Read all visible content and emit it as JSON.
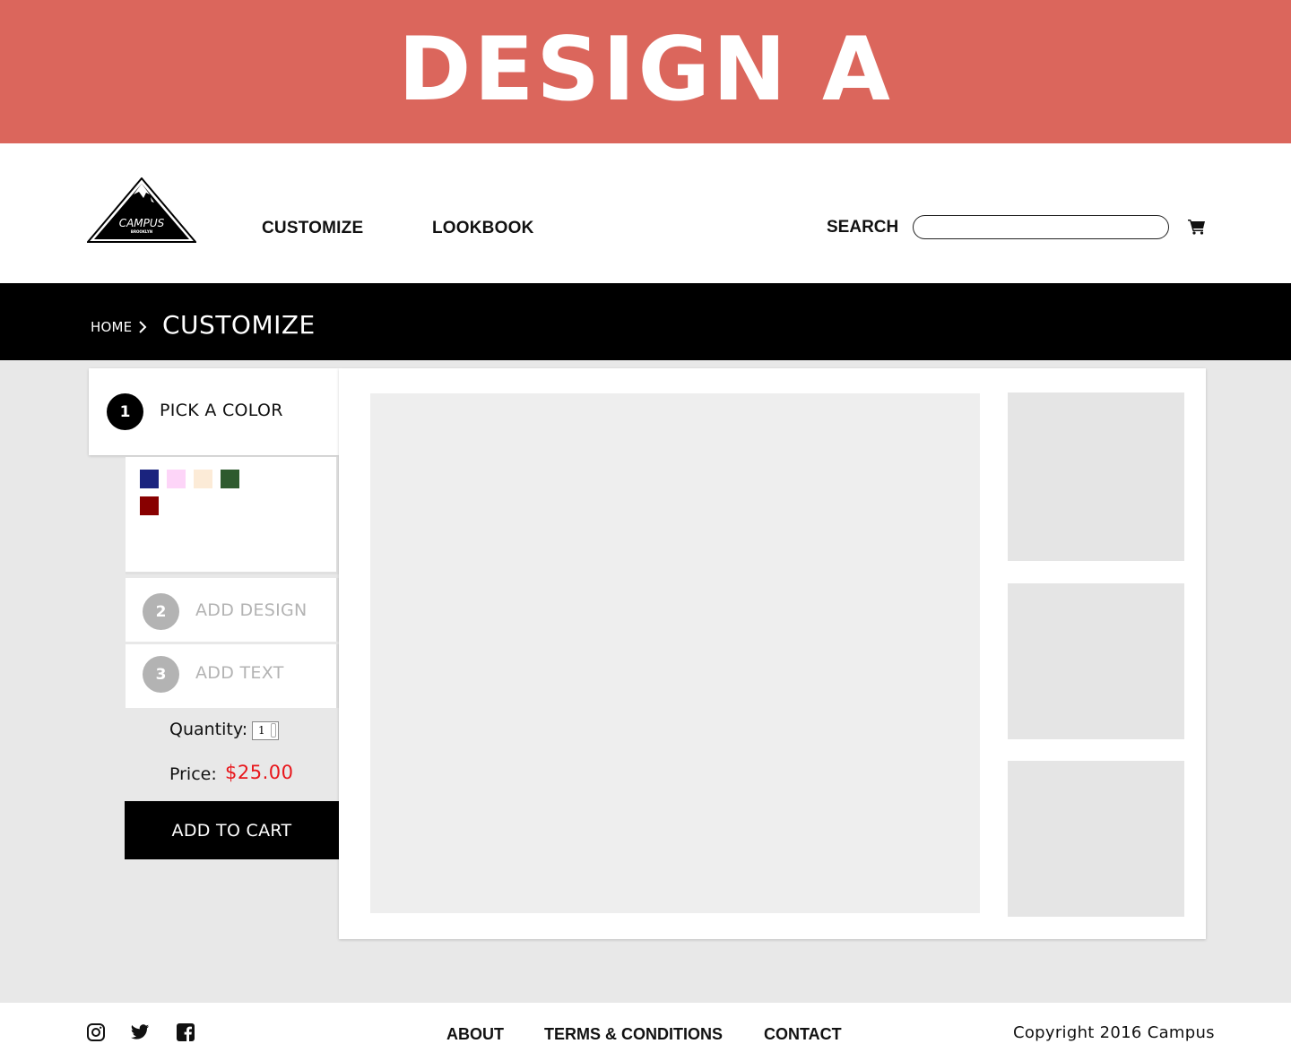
{
  "banner": {
    "title": "DESIGN A"
  },
  "header": {
    "logo": {
      "text": "CAMPUS",
      "subtext": "BROOKLYN"
    },
    "nav": [
      {
        "label": "CUSTOMIZE"
      },
      {
        "label": "LOOKBOOK"
      }
    ],
    "search": {
      "label": "SEARCH",
      "value": ""
    },
    "cart_icon": "shopping-cart-icon"
  },
  "breadcrumb": {
    "home": "HOME",
    "separator_icon": "chevron-right-icon",
    "current": "CUSTOMIZE"
  },
  "customizer": {
    "steps": [
      {
        "number": "1",
        "label": "PICK A COLOR",
        "active": true
      },
      {
        "number": "2",
        "label": "ADD DESIGN",
        "active": false
      },
      {
        "number": "3",
        "label": "ADD TEXT",
        "active": false
      }
    ],
    "colors": [
      "#1a237e",
      "#fdd5f8",
      "#fcebd7",
      "#2e5a2e",
      "#880000"
    ],
    "quantity": {
      "label": "Quantity:",
      "value": "1"
    },
    "price": {
      "label": "Price:",
      "value": "$25.00"
    },
    "add_to_cart": "ADD TO CART"
  },
  "footer": {
    "social": [
      "instagram-icon",
      "twitter-icon",
      "facebook-icon"
    ],
    "links": [
      {
        "label": "ABOUT"
      },
      {
        "label": "TERMS & CONDITIONS"
      },
      {
        "label": "CONTACT"
      }
    ],
    "copyright": "Copyright 2016 Campus"
  },
  "theme": {
    "banner": "#db665c",
    "price": "#e8161b",
    "inactive_step": "#b3b3b3",
    "page_bg": "#e8e8e8"
  }
}
